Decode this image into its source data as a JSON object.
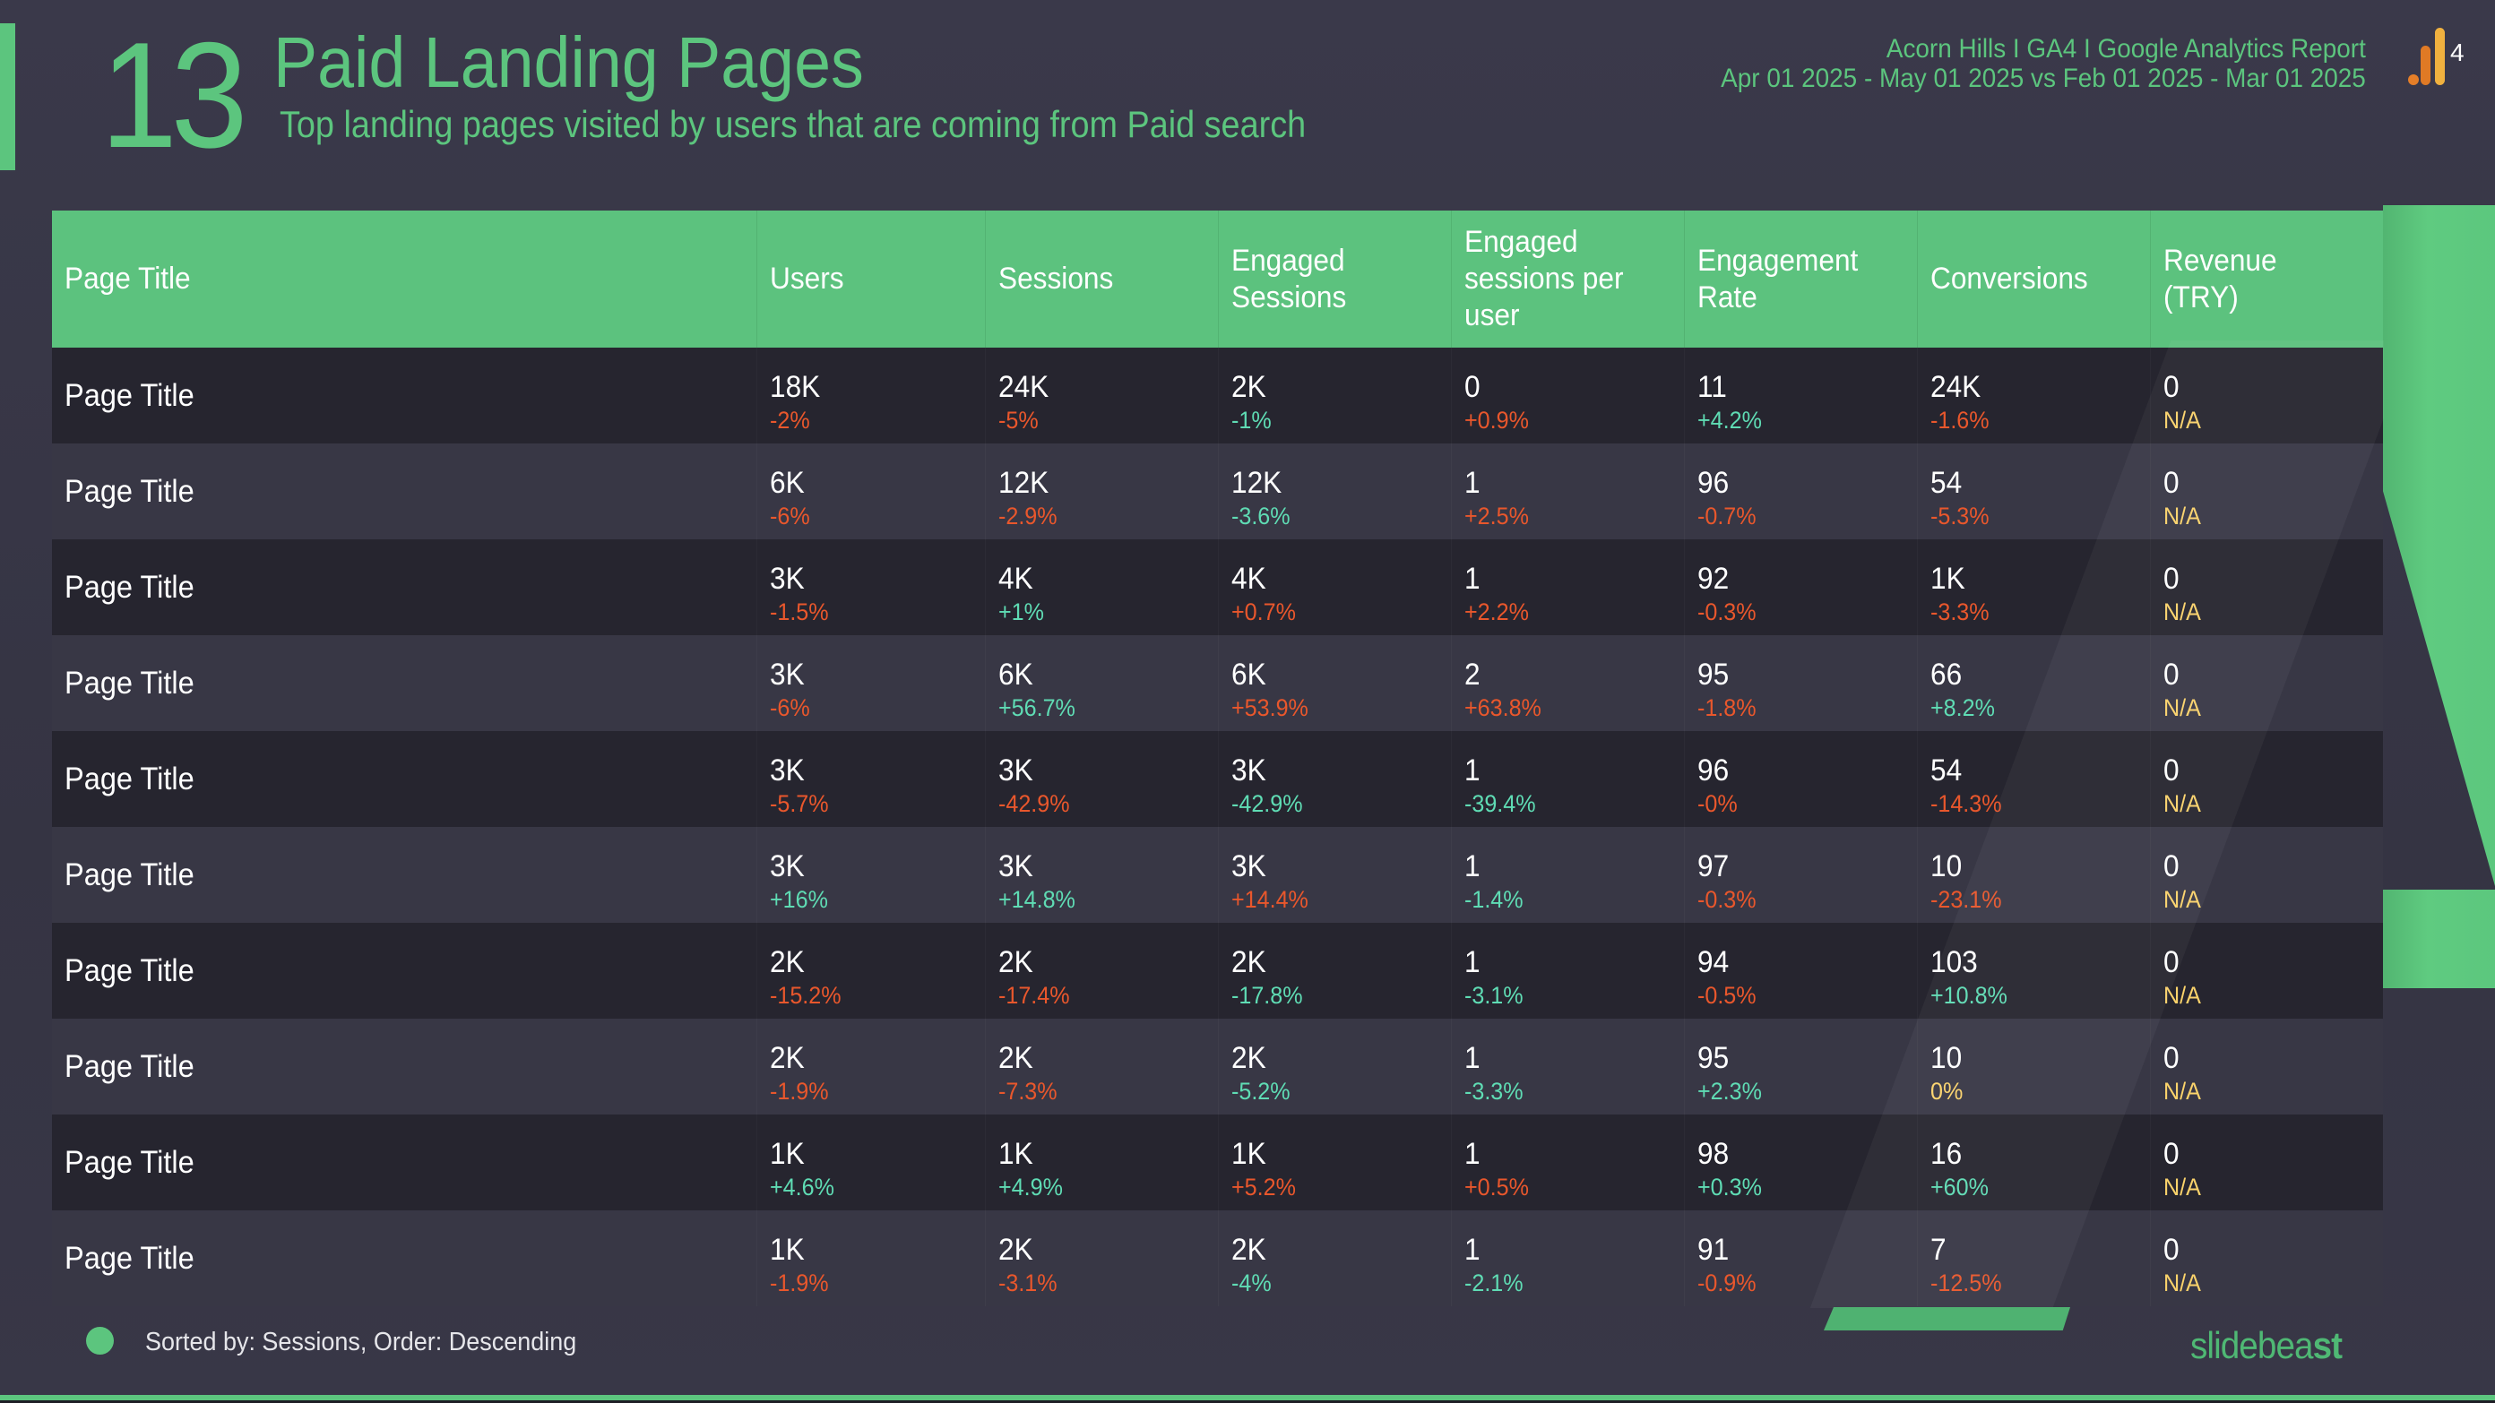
{
  "header": {
    "slide_number": "13",
    "title": "Paid Landing Pages",
    "subtitle": "Top landing pages visited by users that are coming from Paid search",
    "report_line": "Acorn Hills I GA4 I Google Analytics Report",
    "date_range": "Apr 01 2025 - May 01 2025 vs Feb 01 2025 - Mar 01 2025",
    "logo_icon": "google-analytics-4-icon",
    "logo_badge": "4"
  },
  "colors": {
    "accent": "#5cc57e",
    "negative": "#e9572c",
    "positive": "#5fdcb4",
    "neutral": "#fbd36b",
    "background": "#393848"
  },
  "table": {
    "columns": [
      "Page Title",
      "Users",
      "Sessions",
      "Engaged Sessions",
      "Engaged sessions per user",
      "Engagement Rate",
      "Conversions",
      "Revenue (TRY)"
    ],
    "rows": [
      {
        "page": "Page Title",
        "cells": [
          {
            "v": "18K",
            "c": "-2%",
            "s": "bad"
          },
          {
            "v": "24K",
            "c": "-5%",
            "s": "bad"
          },
          {
            "v": "2K",
            "c": "-1%",
            "s": "good"
          },
          {
            "v": "0",
            "c": "+0.9%",
            "s": "bad"
          },
          {
            "v": "11",
            "c": "+4.2%",
            "s": "good"
          },
          {
            "v": "24K",
            "c": "-1.6%",
            "s": "bad"
          },
          {
            "v": "0",
            "c": "N/A",
            "s": "neutral"
          }
        ]
      },
      {
        "page": "Page Title",
        "cells": [
          {
            "v": "6K",
            "c": "-6%",
            "s": "bad"
          },
          {
            "v": "12K",
            "c": "-2.9%",
            "s": "bad"
          },
          {
            "v": "12K",
            "c": "-3.6%",
            "s": "good"
          },
          {
            "v": "1",
            "c": "+2.5%",
            "s": "bad"
          },
          {
            "v": "96",
            "c": "-0.7%",
            "s": "bad"
          },
          {
            "v": "54",
            "c": "-5.3%",
            "s": "bad"
          },
          {
            "v": "0",
            "c": "N/A",
            "s": "neutral"
          }
        ]
      },
      {
        "page": "Page Title",
        "cells": [
          {
            "v": "3K",
            "c": "-1.5%",
            "s": "bad"
          },
          {
            "v": "4K",
            "c": "+1%",
            "s": "good"
          },
          {
            "v": "4K",
            "c": "+0.7%",
            "s": "bad"
          },
          {
            "v": "1",
            "c": "+2.2%",
            "s": "bad"
          },
          {
            "v": "92",
            "c": "-0.3%",
            "s": "bad"
          },
          {
            "v": "1K",
            "c": "-3.3%",
            "s": "bad"
          },
          {
            "v": "0",
            "c": "N/A",
            "s": "neutral"
          }
        ]
      },
      {
        "page": "Page Title",
        "cells": [
          {
            "v": "3K",
            "c": "-6%",
            "s": "bad"
          },
          {
            "v": "6K",
            "c": "+56.7%",
            "s": "good"
          },
          {
            "v": "6K",
            "c": "+53.9%",
            "s": "bad"
          },
          {
            "v": "2",
            "c": "+63.8%",
            "s": "bad"
          },
          {
            "v": "95",
            "c": "-1.8%",
            "s": "bad"
          },
          {
            "v": "66",
            "c": "+8.2%",
            "s": "good"
          },
          {
            "v": "0",
            "c": "N/A",
            "s": "neutral"
          }
        ]
      },
      {
        "page": "Page Title",
        "cells": [
          {
            "v": "3K",
            "c": "-5.7%",
            "s": "bad"
          },
          {
            "v": "3K",
            "c": "-42.9%",
            "s": "bad"
          },
          {
            "v": "3K",
            "c": "-42.9%",
            "s": "good"
          },
          {
            "v": "1",
            "c": "-39.4%",
            "s": "good"
          },
          {
            "v": "96",
            "c": "-0%",
            "s": "bad"
          },
          {
            "v": "54",
            "c": "-14.3%",
            "s": "bad"
          },
          {
            "v": "0",
            "c": "N/A",
            "s": "neutral"
          }
        ]
      },
      {
        "page": "Page Title",
        "cells": [
          {
            "v": "3K",
            "c": "+16%",
            "s": "good"
          },
          {
            "v": "3K",
            "c": "+14.8%",
            "s": "good"
          },
          {
            "v": "3K",
            "c": "+14.4%",
            "s": "bad"
          },
          {
            "v": "1",
            "c": "-1.4%",
            "s": "good"
          },
          {
            "v": "97",
            "c": "-0.3%",
            "s": "bad"
          },
          {
            "v": "10",
            "c": "-23.1%",
            "s": "bad"
          },
          {
            "v": "0",
            "c": "N/A",
            "s": "neutral"
          }
        ]
      },
      {
        "page": "Page Title",
        "cells": [
          {
            "v": "2K",
            "c": "-15.2%",
            "s": "bad"
          },
          {
            "v": "2K",
            "c": "-17.4%",
            "s": "bad"
          },
          {
            "v": "2K",
            "c": "-17.8%",
            "s": "good"
          },
          {
            "v": "1",
            "c": "-3.1%",
            "s": "good"
          },
          {
            "v": "94",
            "c": "-0.5%",
            "s": "bad"
          },
          {
            "v": "103",
            "c": "+10.8%",
            "s": "good"
          },
          {
            "v": "0",
            "c": "N/A",
            "s": "neutral"
          }
        ]
      },
      {
        "page": "Page Title",
        "cells": [
          {
            "v": "2K",
            "c": "-1.9%",
            "s": "bad"
          },
          {
            "v": "2K",
            "c": "-7.3%",
            "s": "bad"
          },
          {
            "v": "2K",
            "c": "-5.2%",
            "s": "good"
          },
          {
            "v": "1",
            "c": "-3.3%",
            "s": "good"
          },
          {
            "v": "95",
            "c": "+2.3%",
            "s": "good"
          },
          {
            "v": "10",
            "c": "0%",
            "s": "neutral"
          },
          {
            "v": "0",
            "c": "N/A",
            "s": "neutral"
          }
        ]
      },
      {
        "page": "Page Title",
        "cells": [
          {
            "v": "1K",
            "c": "+4.6%",
            "s": "good"
          },
          {
            "v": "1K",
            "c": "+4.9%",
            "s": "good"
          },
          {
            "v": "1K",
            "c": "+5.2%",
            "s": "bad"
          },
          {
            "v": "1",
            "c": "+0.5%",
            "s": "bad"
          },
          {
            "v": "98",
            "c": "+0.3%",
            "s": "good"
          },
          {
            "v": "16",
            "c": "+60%",
            "s": "good"
          },
          {
            "v": "0",
            "c": "N/A",
            "s": "neutral"
          }
        ]
      },
      {
        "page": "Page Title",
        "cells": [
          {
            "v": "1K",
            "c": "-1.9%",
            "s": "bad"
          },
          {
            "v": "2K",
            "c": "-3.1%",
            "s": "bad"
          },
          {
            "v": "2K",
            "c": "-4%",
            "s": "good"
          },
          {
            "v": "1",
            "c": "-2.1%",
            "s": "good"
          },
          {
            "v": "91",
            "c": "-0.9%",
            "s": "bad"
          },
          {
            "v": "7",
            "c": "-12.5%",
            "s": "bad"
          },
          {
            "v": "0",
            "c": "N/A",
            "s": "neutral"
          }
        ]
      }
    ]
  },
  "footer": {
    "sort_note": "Sorted by: Sessions, Order: Descending",
    "brand_light": "slidebea",
    "brand_bold": "st"
  }
}
